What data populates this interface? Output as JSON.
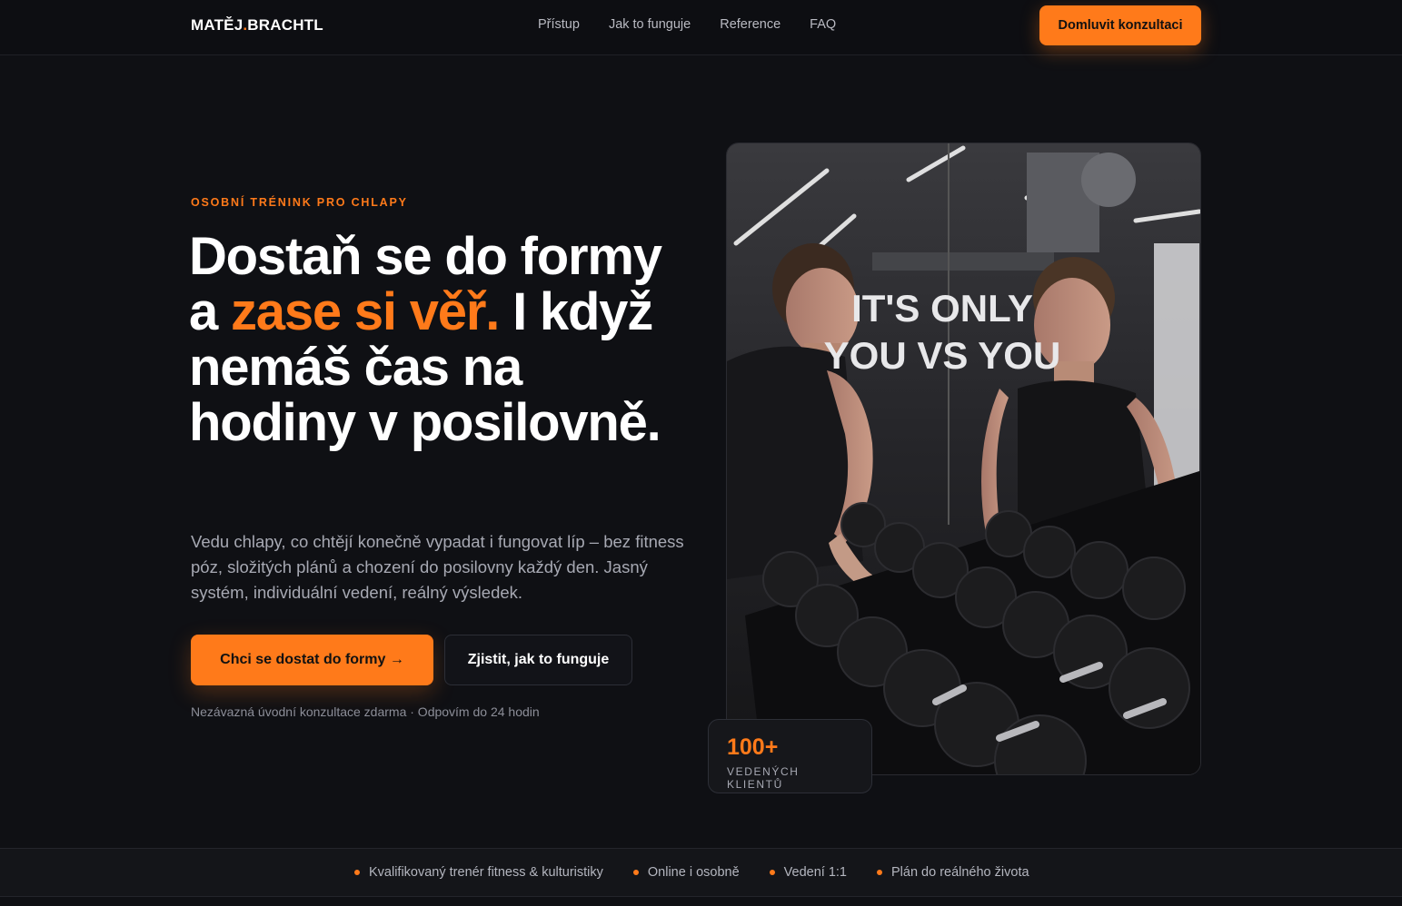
{
  "nav": {
    "logo_part1": "MATĚJ",
    "logo_dot": ".",
    "logo_part2": "BRACHTL",
    "links": [
      "Přístup",
      "Jak to funguje",
      "Reference",
      "FAQ"
    ],
    "cta_label": "Domluvit konzultaci"
  },
  "hero": {
    "eyebrow": "OSOBNÍ TRÉNINK PRO CHLAPY",
    "headline_part1": "Dostaň se do formy a ",
    "headline_accent": "zase si věř.",
    "headline_part2": " I když nemáš čas na hodiny v posilovně.",
    "lead": "Vedu chlapy, co chtějí konečně vypadat i fungovat líp – bez fitness póz, složitých plánů a chození do posilovny každý den. Jasný systém, individuální vedení, reálný výsledek.",
    "primary_button": "Chci se dostat do formy →",
    "secondary_button": "Zjistit, jak to funguje",
    "note": "Nezávazná úvodní konzultace zdarma · Odpovím do 24 hodin"
  },
  "photo": {
    "overlay_line1": "IT'S ONLY",
    "overlay_line2": "YOU VS YOU"
  },
  "stat": {
    "value": "100+",
    "label": "VEDENÝCH KLIENTŮ"
  },
  "strip": {
    "items": [
      "Kvalifikovaný trenér fitness & kulturistiky",
      "Online i osobně",
      "Vedení 1:1",
      "Plán do reálného života"
    ]
  },
  "colors": {
    "accent": "#ff7a1a",
    "background": "#0f1014"
  }
}
